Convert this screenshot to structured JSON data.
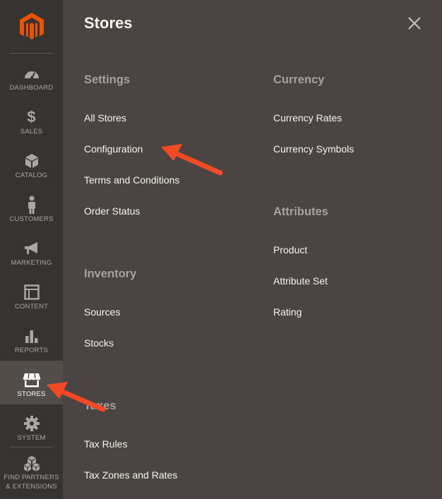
{
  "sidebar": {
    "items": [
      {
        "label": "DASHBOARD",
        "icon": "dashboard-icon"
      },
      {
        "label": "SALES",
        "icon": "dollar-icon"
      },
      {
        "label": "CATALOG",
        "icon": "cube-icon"
      },
      {
        "label": "CUSTOMERS",
        "icon": "person-icon"
      },
      {
        "label": "MARKETING",
        "icon": "megaphone-icon"
      },
      {
        "label": "CONTENT",
        "icon": "layout-icon"
      },
      {
        "label": "REPORTS",
        "icon": "bar-chart-icon"
      },
      {
        "label": "STORES",
        "icon": "storefront-icon"
      },
      {
        "label": "SYSTEM",
        "icon": "gear-icon"
      },
      {
        "label_line1": "FIND PARTNERS",
        "label_line2": "& EXTENSIONS",
        "icon": "boxes-icon"
      }
    ]
  },
  "panel": {
    "title": "Stores",
    "groups": {
      "settings": {
        "title": "Settings",
        "links": [
          "All Stores",
          "Configuration",
          "Terms and Conditions",
          "Order Status"
        ]
      },
      "inventory": {
        "title": "Inventory",
        "links": [
          "Sources",
          "Stocks"
        ]
      },
      "taxes": {
        "title": "Taxes",
        "links": [
          "Tax Rules",
          "Tax Zones and Rates"
        ]
      },
      "currency": {
        "title": "Currency",
        "links": [
          "Currency Rates",
          "Currency Symbols"
        ]
      },
      "attributes": {
        "title": "Attributes",
        "links": [
          "Product",
          "Attribute Set",
          "Rating"
        ]
      }
    }
  },
  "colors": {
    "sidebar_bg": "#373330",
    "panel_bg": "#4a4542",
    "active_bg": "#524d49",
    "logo_orange": "#eb5202",
    "annotation_arrow": "#f24a25"
  }
}
